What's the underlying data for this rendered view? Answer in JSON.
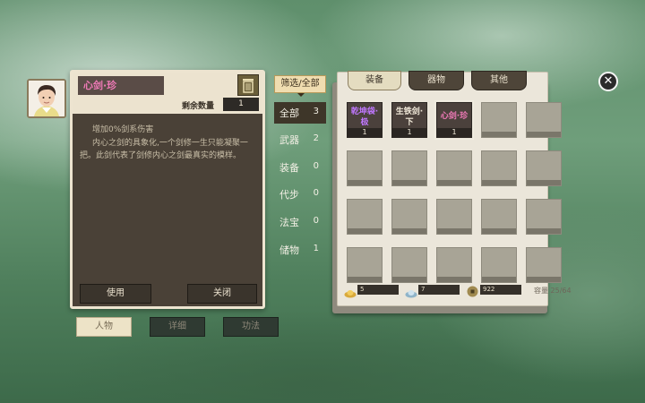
{
  "detail": {
    "item_name": "心剑·珍",
    "remain_label": "剩余数量",
    "remain_value": "1",
    "desc_line1": "增加0%剑系伤害",
    "desc_line2": "内心之剑的具象化,一个剑修一生只能凝聚一把。此剑代表了剑修内心之剑最真实的模样。",
    "use_label": "使用",
    "close_label": "关闭",
    "trash_icon": "trash-icon"
  },
  "bottom_tabs": [
    "人物",
    "详细",
    "功法"
  ],
  "filter": {
    "label": "筛选/全部",
    "categories": [
      {
        "label": "全部",
        "count": "3"
      },
      {
        "label": "武器",
        "count": "2"
      },
      {
        "label": "装备",
        "count": "0"
      },
      {
        "label": "代步",
        "count": "0"
      },
      {
        "label": "法宝",
        "count": "0"
      },
      {
        "label": "储物",
        "count": "1"
      }
    ]
  },
  "inventory": {
    "tabs": [
      "装备",
      "器物",
      "其他"
    ],
    "items": [
      {
        "name": "乾坤袋·极",
        "count": "1",
        "color": "#c077ff"
      },
      {
        "name": "生铁剑·下",
        "count": "1",
        "color": "#f0e8d8"
      },
      {
        "name": "心剑·珍",
        "count": "1",
        "color": "#f07ab8"
      }
    ],
    "currency": [
      {
        "icon": "gold-ingot-icon",
        "value": "5"
      },
      {
        "icon": "silver-ingot-icon",
        "value": "7"
      },
      {
        "icon": "copper-coin-icon",
        "value": "922"
      }
    ],
    "capacity": "容量 25/64"
  },
  "close_icon": "close-icon",
  "colors": {
    "rare_name": "#f07ab8",
    "epic_name": "#c077ff"
  }
}
